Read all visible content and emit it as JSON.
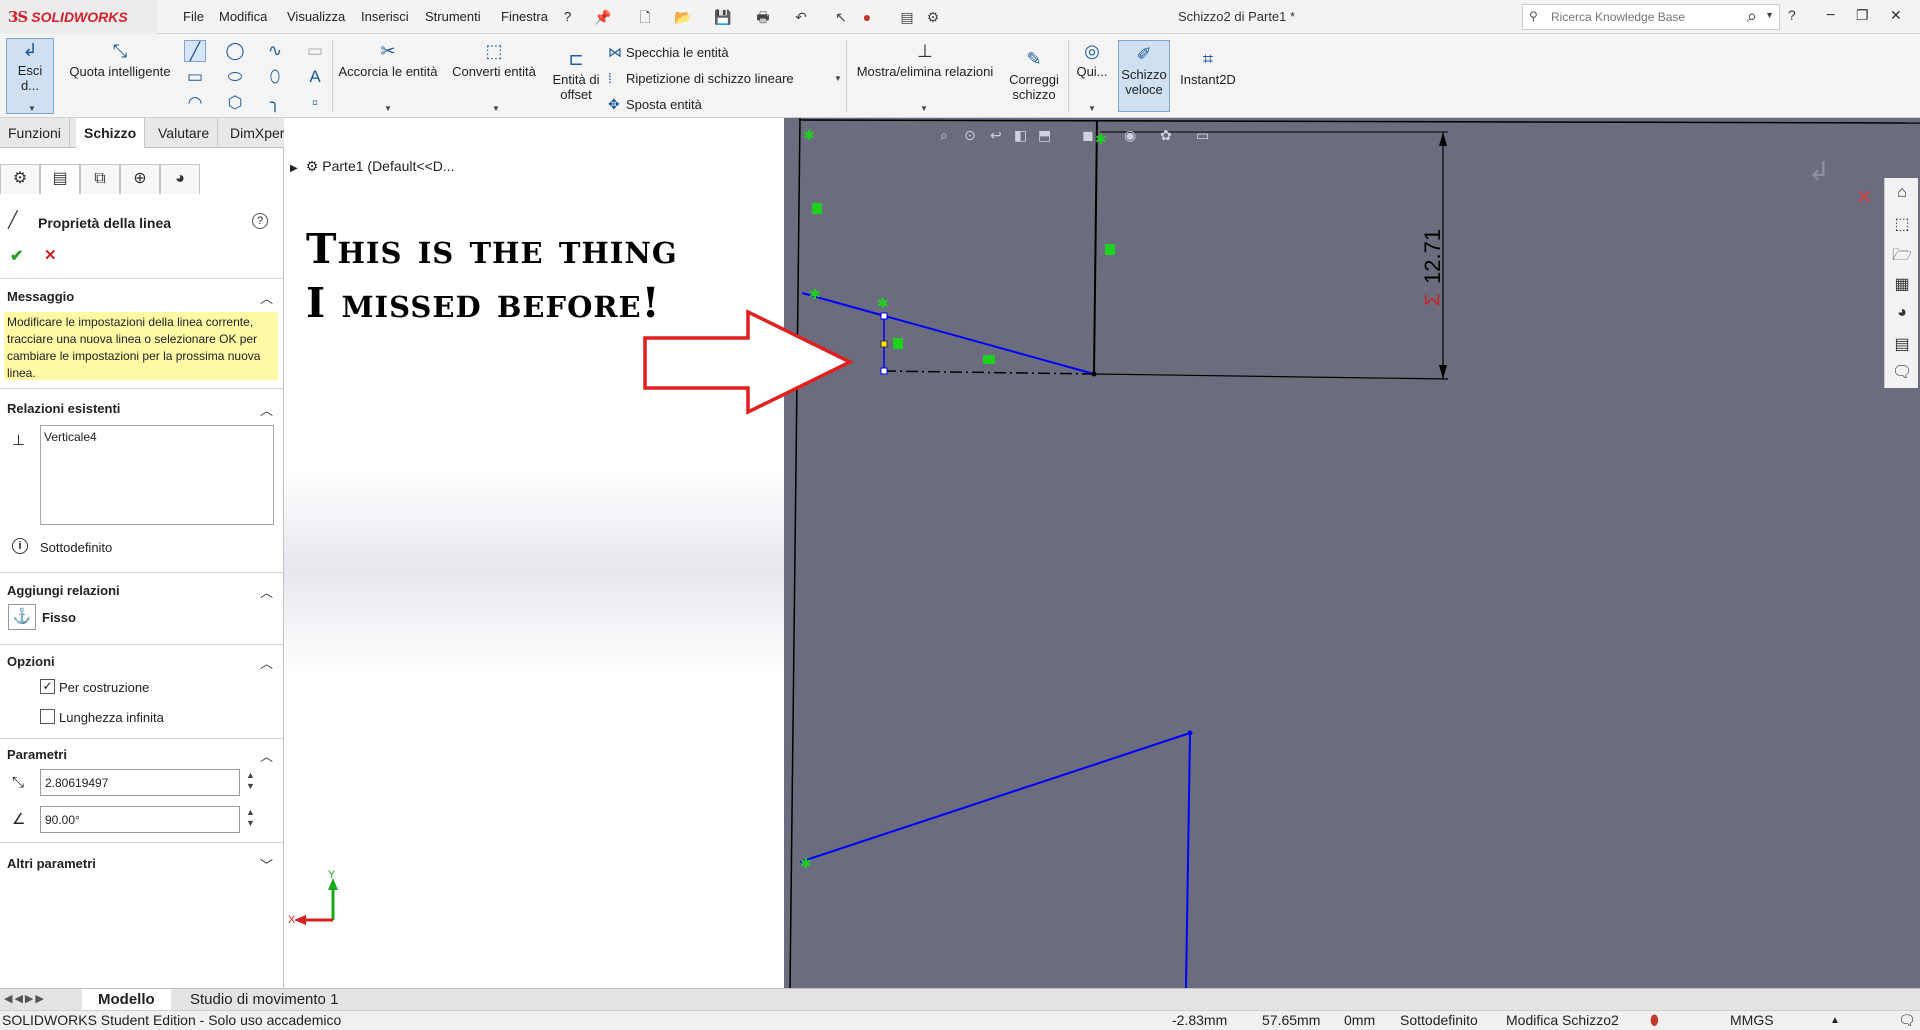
{
  "app": {
    "brand_mark": "3S",
    "brand_name": "SOLIDWORKS"
  },
  "menu": [
    "File",
    "Modifica",
    "Visualizza",
    "Inserisci",
    "Strumenti",
    "Finestra",
    "?"
  ],
  "doc_title": "Schizzo2 di Parte1 *",
  "search": {
    "placeholder": "Ricerca Knowledge Base"
  },
  "commands": {
    "exit_sketch": "Esci d...",
    "smart_dim": "Quota intelligente",
    "trim": "Accorcia le entità",
    "convert": "Converti entità",
    "offset_1": "Entità di",
    "offset_2": "offset",
    "mirror": "Specchia le entità",
    "linear_pattern": "Ripetizione di schizzo lineare",
    "move": "Sposta entità",
    "relations": "Mostra/elimina relazioni",
    "repair_1": "Correggi",
    "repair_2": "schizzo",
    "quick": "Qui...",
    "rapid_1": "Schizzo",
    "rapid_2": "veloce",
    "instant2d": "Instant2D"
  },
  "tabs": [
    "Funzioni",
    "Schizzo",
    "Valutare",
    "DimXpert"
  ],
  "active_tab": "Schizzo",
  "pm": {
    "title": "Proprietà della linea",
    "message_title": "Messaggio",
    "message": "Modificare le impostazioni della linea corrente, tracciare una nuova linea o selezionare OK per cambiare le impostazioni per la prossima nuova linea.",
    "relations_title": "Relazioni esistenti",
    "relations": [
      "Verticale4"
    ],
    "status": "Sottodefinito",
    "add_relations_title": "Aggiungi relazioni",
    "fixed": "Fisso",
    "options_title": "Opzioni",
    "for_construction": "Per costruzione",
    "for_construction_checked": true,
    "infinite_length": "Lunghezza infinita",
    "infinite_length_checked": false,
    "params_title": "Parametri",
    "length_value": "2.80619497",
    "angle_value": "90.00°",
    "more_params_title": "Altri parametri"
  },
  "tree": {
    "root": "Parte1  (Default<<D..."
  },
  "annotation": {
    "line1": "This is the thing",
    "line2": "I missed before!"
  },
  "dimension": {
    "value": "12.71"
  },
  "triad": {
    "x": "X",
    "y": "Y"
  },
  "bottom_tabs": [
    "Modello",
    "Studio di movimento 1"
  ],
  "status": {
    "edition": "SOLIDWORKS Student Edition - Solo uso accademico",
    "x": "-2.83mm",
    "y": "57.65mm",
    "z": "0mm",
    "state": "Sottodefinito",
    "editing": "Modifica Schizzo2",
    "units": "MMGS"
  },
  "colors": {
    "brand": "#d4202a",
    "canvas": "#6b6d7e",
    "sketch_line": "#0000ff",
    "message_bg": "#fff9a6",
    "arrow": "#e0201e",
    "relation_badge": "#1fd11f"
  }
}
